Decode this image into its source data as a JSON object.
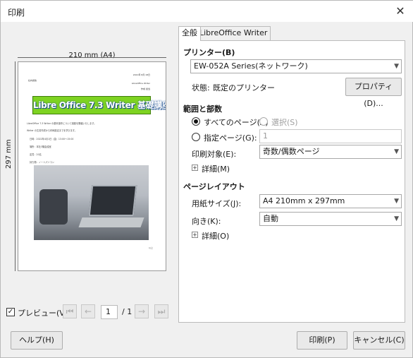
{
  "window": {
    "title": "印刷",
    "close_glyph": "✕"
  },
  "preview": {
    "width_label": "210 mm (A4)",
    "height_label": "297 mm",
    "doc": {
      "header_date": "2021年 8月 18日",
      "header_left": "社内報告",
      "header_right1": "LibreOffice Writer",
      "header_right2": "作成  担当",
      "banner": "Libre Office 7.3 Writer 基礎講座のお知らせ",
      "line1": "LibreOffice 7.3 Writer の基本操作について講座を開催いたします。",
      "line2": "Writer の文書作成から印刷設定までを学びます。",
      "bullets": [
        "日時：2022年4月1日（金）13:00〜15:00",
        "場所：本社3階会議室",
        "定員：20名",
        "持ち物：ノートパソコン"
      ],
      "page_no": "以上"
    }
  },
  "bottom": {
    "preview_checkbox_label": "プレビュー(V)",
    "preview_checked": true,
    "page_current": "1",
    "page_total": "/ 1",
    "help_button": "ヘルプ(H)",
    "print_button": "印刷(P)",
    "cancel_button": "キャンセル(C)"
  },
  "tabs": [
    {
      "label": "全般",
      "active": true
    },
    {
      "label": "LibreOffice Writer",
      "active": false
    }
  ],
  "printer": {
    "section": "プリンター(B)",
    "selected": "EW-052A Series(ネットワーク)",
    "status_label": "状態:",
    "status_value": "既定のプリンター",
    "properties_button": "プロパティ(D)..."
  },
  "range": {
    "section": "範囲と部数",
    "all_pages": "すべてのページ(A)",
    "selection": "選択(S)",
    "specific_pages": "指定ページ(G):",
    "pages_value": "1",
    "print_target_label": "印刷対象(E):",
    "print_target_value": "奇数/偶数ページ",
    "details": "詳細(M)"
  },
  "layout": {
    "section": "ページレイアウト",
    "paper_size_label": "用紙サイズ(J):",
    "paper_size_value": "A4 210mm x 297mm",
    "orientation_label": "向き(K):",
    "orientation_value": "自動",
    "details": "詳細(O)"
  }
}
